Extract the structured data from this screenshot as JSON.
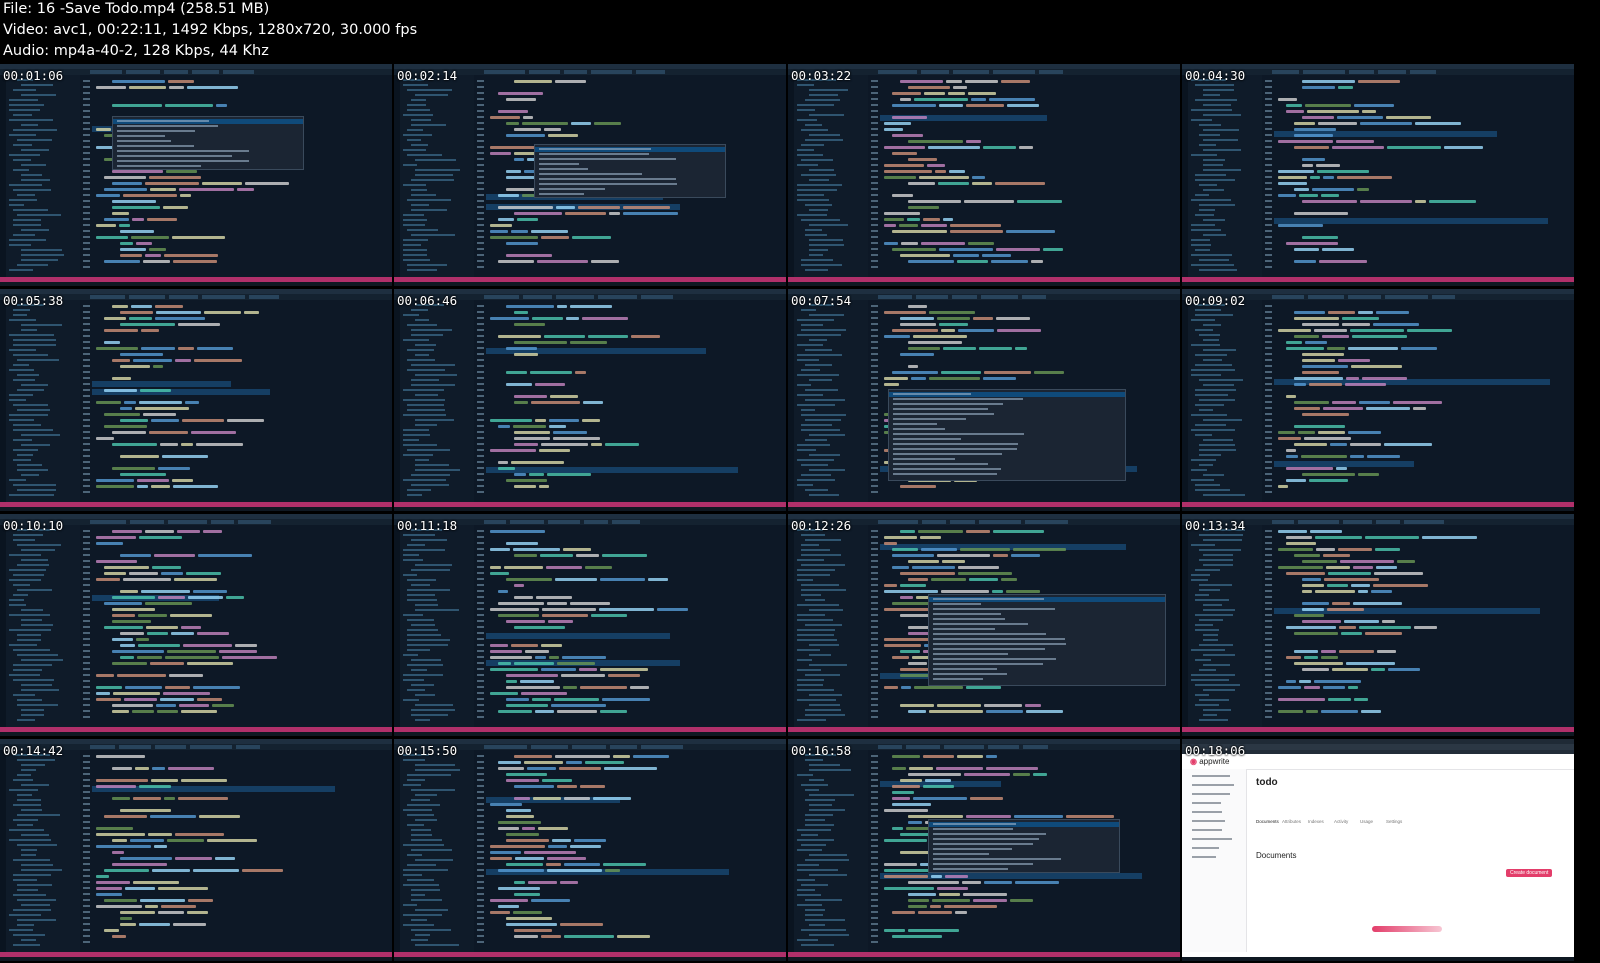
{
  "header": {
    "file": "File: 16 -Save Todo.mp4 (258.51 MB)",
    "video": "Video: avc1, 00:22:11, 1492 Kbps, 1280x720, 30.000 fps",
    "audio": "Audio: mp4a-40-2, 128 Kbps, 44 Khz"
  },
  "thumbnails": [
    {
      "timestamp": "00:01:06",
      "kind": "editor"
    },
    {
      "timestamp": "00:02:14",
      "kind": "editor"
    },
    {
      "timestamp": "00:03:22",
      "kind": "editor"
    },
    {
      "timestamp": "00:04:30",
      "kind": "editor"
    },
    {
      "timestamp": "00:05:38",
      "kind": "editor"
    },
    {
      "timestamp": "00:06:46",
      "kind": "editor"
    },
    {
      "timestamp": "00:07:54",
      "kind": "editor"
    },
    {
      "timestamp": "00:09:02",
      "kind": "editor"
    },
    {
      "timestamp": "00:10:10",
      "kind": "editor"
    },
    {
      "timestamp": "00:11:18",
      "kind": "editor"
    },
    {
      "timestamp": "00:12:26",
      "kind": "editor"
    },
    {
      "timestamp": "00:13:34",
      "kind": "editor"
    },
    {
      "timestamp": "00:14:42",
      "kind": "editor"
    },
    {
      "timestamp": "00:15:50",
      "kind": "editor"
    },
    {
      "timestamp": "00:16:58",
      "kind": "editor"
    },
    {
      "timestamp": "00:18:06",
      "kind": "browser"
    }
  ],
  "browser_thumb": {
    "logo": "appwrite",
    "collection_title": "todo",
    "section_heading": "Documents",
    "create_button": "Create document",
    "tabs": [
      "Documents",
      "Attributes",
      "Indexes",
      "Activity",
      "Usage",
      "Settings"
    ]
  },
  "colors": {
    "background": "#000000",
    "editor_bg": "#0d1826",
    "status_bar": "#b0306a",
    "brand_accent": "#e33d6a"
  }
}
